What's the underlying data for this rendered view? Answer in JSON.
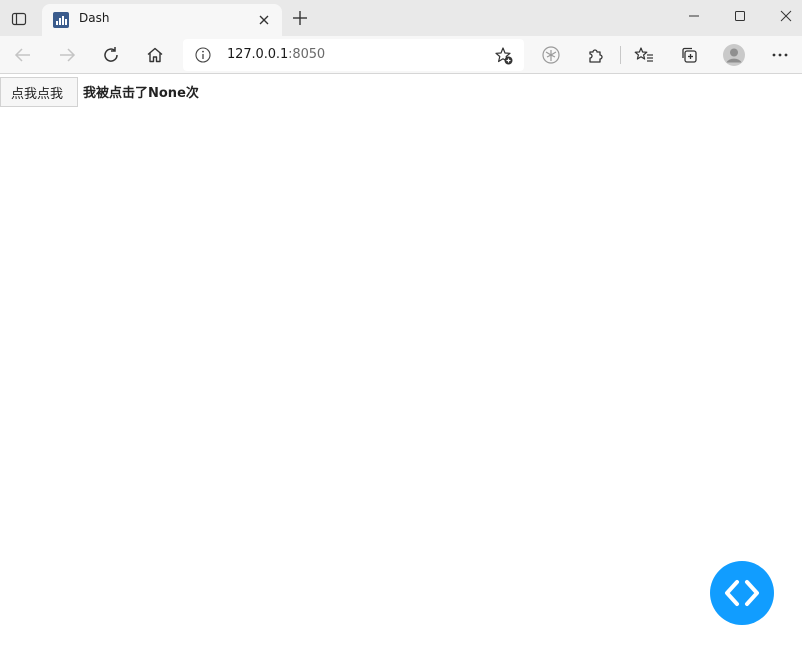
{
  "browser": {
    "tab": {
      "title": "Dash",
      "favicon": "dash-bar-chart-icon"
    },
    "address_bar": {
      "host": "127.0.0.1",
      "port": ":8050"
    },
    "icons": {
      "tab_actions": "tab-actions-icon",
      "close_tab": "close-icon",
      "new_tab": "plus-icon",
      "minimize": "minimize-icon",
      "maximize": "maximize-icon",
      "close_window": "close-window-icon",
      "back": "back-arrow-icon",
      "forward": "forward-arrow-icon",
      "refresh": "refresh-icon",
      "home": "home-icon",
      "site_info": "info-icon",
      "add_favorite": "star-plus-icon",
      "extension_palm": "palm-tree-icon",
      "extensions": "puzzle-icon",
      "favorites": "favorites-list-icon",
      "collections": "collections-icon",
      "profile": "avatar-icon",
      "more": "more-dots-icon"
    }
  },
  "app": {
    "button_label": "点我点我",
    "output_text": "我被点击了None次"
  },
  "colors": {
    "accent": "#119dff",
    "chrome_bg": "#f7f7f7",
    "tabstrip_bg": "#e9e9e9"
  }
}
